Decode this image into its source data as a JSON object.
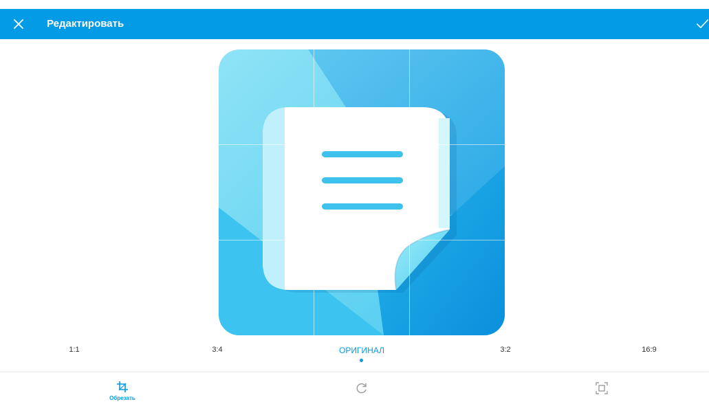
{
  "app_bar": {
    "title": "Редактировать",
    "close_icon": "close-icon",
    "confirm_icon": "check-icon",
    "background": "#039be5"
  },
  "image": {
    "subject": "notes-app-icon",
    "palette": [
      "#7fdcf3",
      "#29b6f6",
      "#0288d1",
      "#ffffff"
    ]
  },
  "aspect_ratios": {
    "options": [
      "1:1",
      "3:4",
      "ОРИГИНАЛ",
      "3:2",
      "16:9"
    ],
    "selected": "ОРИГИНАЛ"
  },
  "toolbar": {
    "crop_label": "Обрезать",
    "crop_icon": "crop-icon",
    "rotate_icon": "rotate-icon",
    "fit_icon": "fit-screen-icon",
    "accent": "#039be5"
  }
}
